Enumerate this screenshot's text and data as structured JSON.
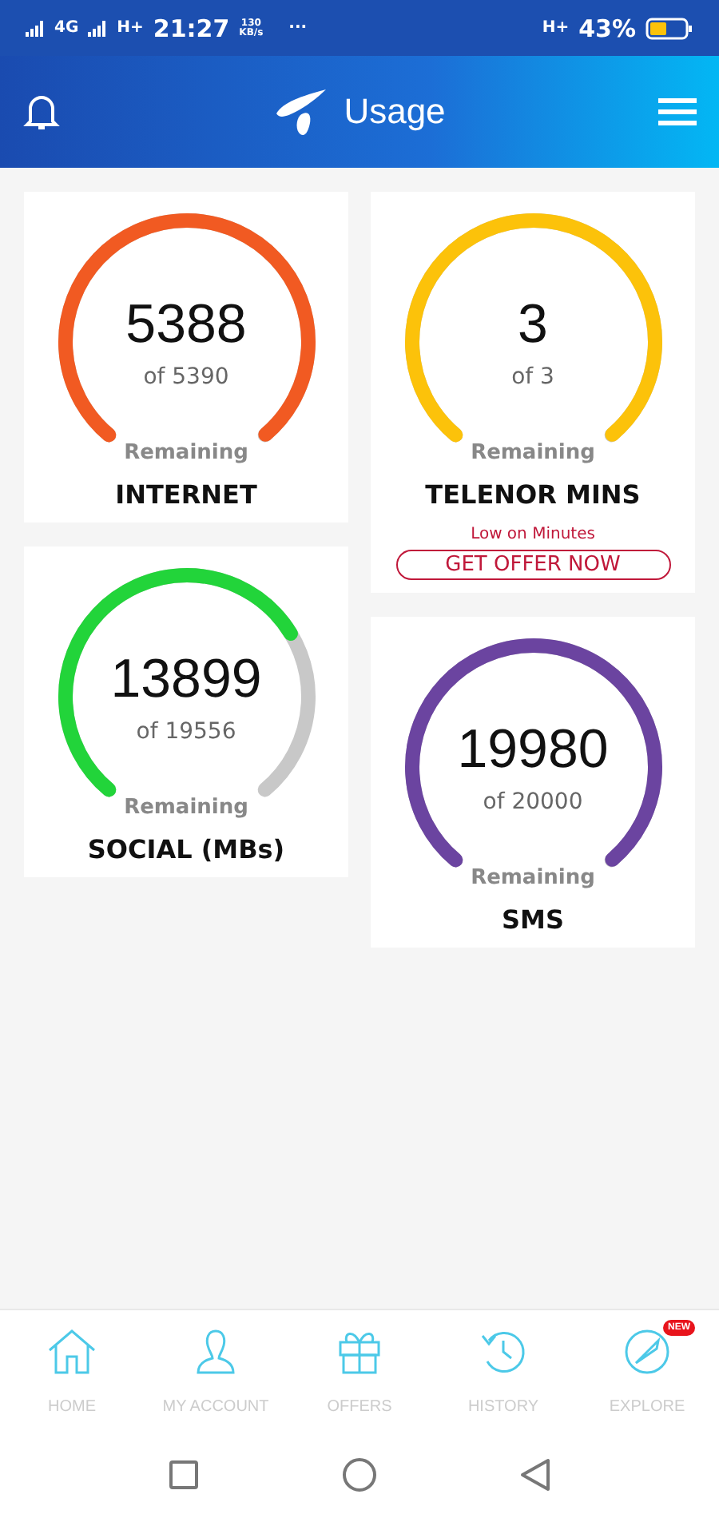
{
  "status_bar": {
    "network_1": "4G",
    "network_2": "H+",
    "time": "21:27",
    "speed_value": "130",
    "speed_unit": "KB/s",
    "more": "···",
    "network_3": "H+",
    "battery": "43%"
  },
  "header": {
    "title": "Usage"
  },
  "columns": [
    {
      "cards": [
        {
          "value": "5388",
          "total": "of 5390",
          "caption": "Remaining",
          "title": "INTERNET",
          "color": "#f15a22"
        },
        {
          "value": "13899",
          "total": "of 19556",
          "caption": "Remaining",
          "title": "SOCIAL (MBs)",
          "color": "#22d43a"
        }
      ]
    },
    {
      "cards": [
        {
          "value": "3",
          "total": "of 3",
          "caption": "Remaining",
          "title": "TELENOR MINS",
          "color": "#fcc20a",
          "warning": "Low on Minutes",
          "action": "GET OFFER NOW"
        },
        {
          "value": "19980",
          "total": "of 20000",
          "caption": "Remaining",
          "title": "SMS",
          "color": "#6b44a0"
        }
      ]
    }
  ],
  "bottom_nav": [
    {
      "kind": "home",
      "label": "HOME"
    },
    {
      "kind": "account",
      "label": "MY ACCOUNT"
    },
    {
      "kind": "offers",
      "label": "OFFERS"
    },
    {
      "kind": "history",
      "label": "HISTORY"
    },
    {
      "kind": "explore",
      "label": "EXPLORE",
      "badge": "NEW"
    }
  ]
}
